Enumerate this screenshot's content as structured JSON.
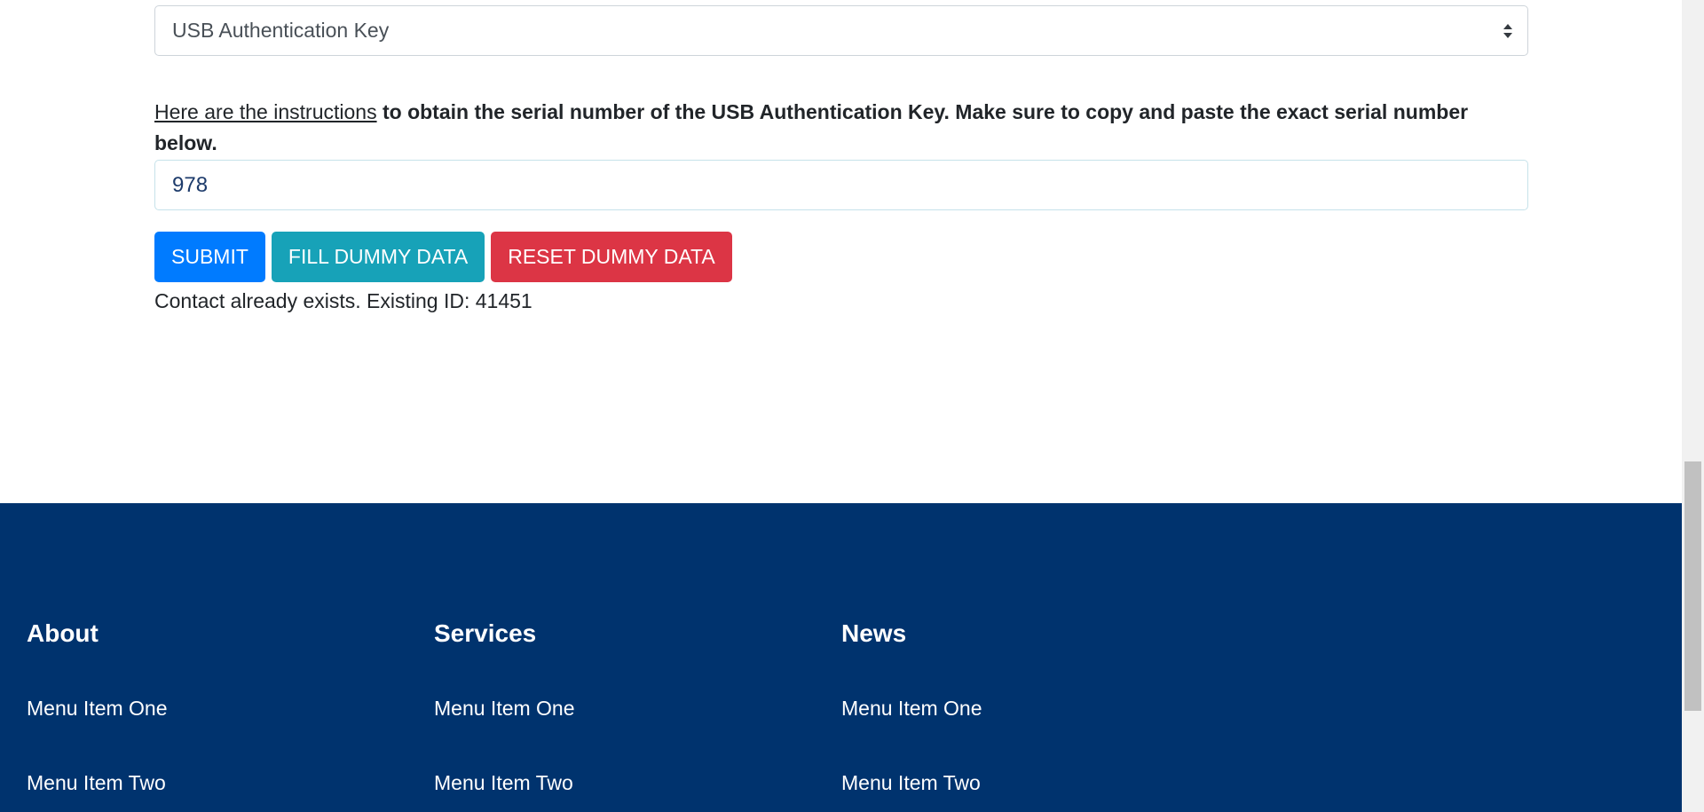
{
  "form": {
    "key_type_select": {
      "selected": "USB Authentication Key"
    },
    "instructions": {
      "link_text": "Here are the instructions",
      "text": " to obtain the serial number of the USB Authentication Key. Make sure to copy and paste the exact serial number below."
    },
    "serial_input": {
      "value": "978"
    },
    "buttons": {
      "submit": "SUBMIT",
      "fill_dummy": "FILL DUMMY DATA",
      "reset_dummy": "RESET DUMMY DATA"
    },
    "status_message": "Contact already exists. Existing ID: 41451"
  },
  "footer": {
    "columns": [
      {
        "heading": "About",
        "items": [
          "Menu Item One",
          "Menu Item Two"
        ]
      },
      {
        "heading": "Services",
        "items": [
          "Menu Item One",
          "Menu Item Two"
        ]
      },
      {
        "heading": "News",
        "items": [
          "Menu Item One",
          "Menu Item Two"
        ]
      }
    ]
  },
  "colors": {
    "footer_bg": "#00336e",
    "submit": "#007bff",
    "fill_dummy": "#17a2b8",
    "reset_dummy": "#dc3545"
  }
}
